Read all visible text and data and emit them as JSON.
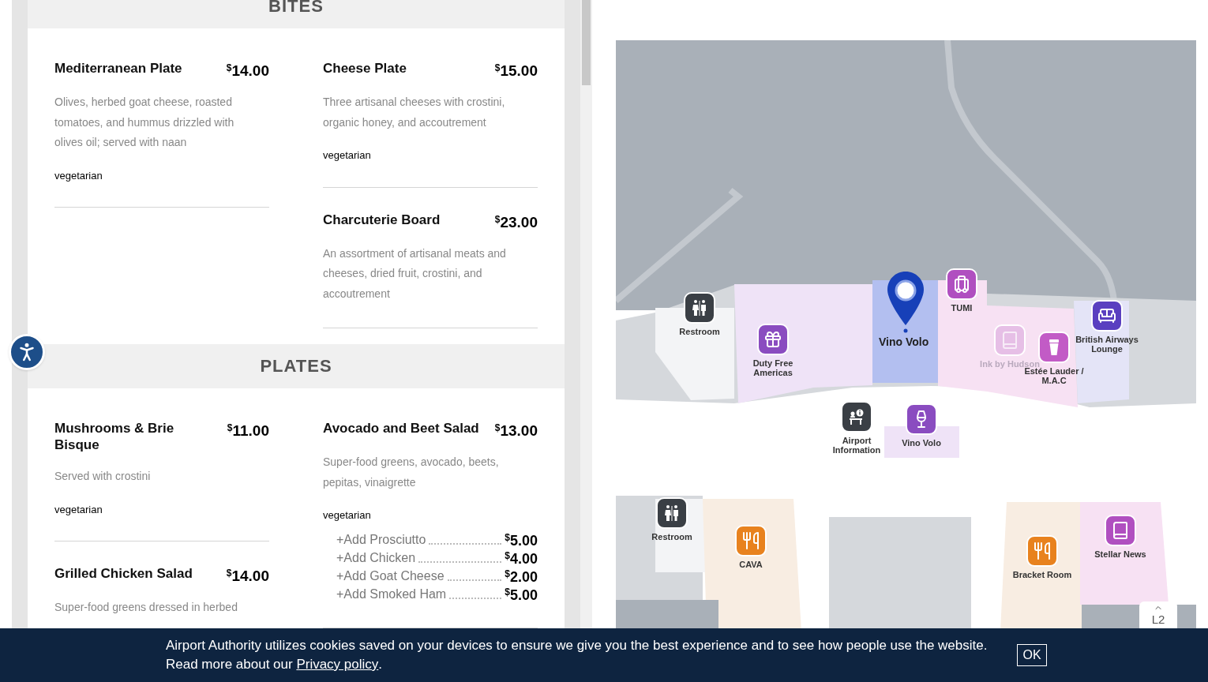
{
  "menu": {
    "sections": [
      {
        "title": "BITES",
        "columns": [
          [
            {
              "name": "Mediterranean Plate",
              "currency": "$",
              "price": "14.00",
              "description": "Olives, herbed goat cheese, roasted tomatoes, and hummus drizzled with olives oil; served with naan",
              "tag": "vegetarian"
            }
          ],
          [
            {
              "name": "Cheese Plate",
              "currency": "$",
              "price": "15.00",
              "description": "Three artisanal cheeses with crostini, organic honey, and accoutrement",
              "tag": "vegetarian"
            },
            {
              "name": "Charcuterie Board",
              "currency": "$",
              "price": "23.00",
              "description": "An assortment of artisanal meats and cheeses, dried fruit, crostini, and accoutrement"
            }
          ]
        ]
      },
      {
        "title": "PLATES",
        "columns": [
          [
            {
              "name": "Mushrooms & Brie Bisque",
              "currency": "$",
              "price": "11.00",
              "description": "Served with crostini",
              "tag": "vegetarian"
            },
            {
              "name": "Grilled Chicken Salad",
              "currency": "$",
              "price": "14.00",
              "description": "Super-food greens dressed in herbed"
            }
          ],
          [
            {
              "name": "Avocado and Beet Salad",
              "currency": "$",
              "price": "13.00",
              "description": "Super-food greens, avocado, beets, pepitas, vinaigrette",
              "tag": "vegetarian",
              "addons": [
                {
                  "label": "+Add Prosciutto",
                  "currency": "$",
                  "price": "5.00"
                },
                {
                  "label": "+Add Chicken",
                  "currency": "$",
                  "price": "4.00"
                },
                {
                  "label": "+Add Goat Cheese",
                  "currency": "$",
                  "price": "2.00"
                },
                {
                  "label": "+Add Smoked Ham",
                  "currency": "$",
                  "price": "5.00"
                }
              ]
            }
          ]
        ]
      }
    ]
  },
  "map": {
    "pin": {
      "label": "Vino Volo"
    },
    "pois": [
      {
        "label": "Restroom",
        "kind": "restroom",
        "color": "#3a3f45",
        "dimmed": false
      },
      {
        "label": "Duty Free Americas",
        "kind": "gift",
        "color": "#8a4cc0",
        "dimmed": false
      },
      {
        "label": "TUMI",
        "kind": "luggage",
        "color": "#b04fc0",
        "dimmed": false
      },
      {
        "label": "Ink by Hudson",
        "kind": "book",
        "color": "#e6bfe6",
        "dimmed": true
      },
      {
        "label": "Estée Lauder / M.A.C",
        "kind": "cosmetics",
        "color": "#c25bc6",
        "dimmed": false
      },
      {
        "label": "British Airways Lounge",
        "kind": "lounge",
        "color": "#5a3fc0",
        "dimmed": false
      },
      {
        "label": "Airport Information",
        "kind": "info",
        "color": "#3a3f45",
        "dimmed": false
      },
      {
        "label": "Vino Volo",
        "kind": "wine",
        "color": "#8a4cc0",
        "dimmed": false
      },
      {
        "label": "Restroom",
        "kind": "restroom",
        "color": "#3a3f45",
        "dimmed": false
      },
      {
        "label": "CAVA",
        "kind": "dining",
        "color": "#e8821e",
        "dimmed": false
      },
      {
        "label": "Bracket Room",
        "kind": "dining",
        "color": "#e8821e",
        "dimmed": false
      },
      {
        "label": "Stellar News",
        "kind": "book",
        "color": "#b04fc0",
        "dimmed": false
      }
    ],
    "level_button": {
      "label": "L2"
    }
  },
  "cookie_banner": {
    "message": "Airport Authority utilizes cookies saved on your devices to ensure we give you the best experience and to see how people use the website.",
    "read_more": "Read more about our",
    "link": "Privacy policy",
    "end": ".",
    "ok": "OK"
  }
}
